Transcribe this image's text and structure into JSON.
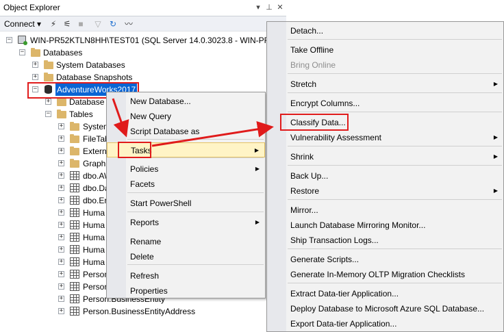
{
  "panel": {
    "title": "Object Explorer",
    "pin_glyph": "▾",
    "autohide_glyph": "📌",
    "close_glyph": "✕",
    "connect_label": "Connect ▾"
  },
  "tree": {
    "server": "WIN-PR52KTLN8HH\\TEST01 (SQL Server 14.0.3023.8 - WIN-PR52K",
    "databases": "Databases",
    "system_databases": "System Databases",
    "database_snapshots": "Database Snapshots",
    "selected_db": "AdventureWorks2017",
    "db_diagrams": "Database D",
    "tables": "Tables",
    "table_items": [
      "System",
      "FileTab",
      "Externa",
      "Graph",
      "dbo.AW",
      "dbo.Da",
      "dbo.Er",
      "Huma",
      "Huma",
      "Huma",
      "Huma",
      "Huma",
      "Person",
      "Person.AddressType",
      "Person.BusinessEntity",
      "Person.BusinessEntityAddress"
    ]
  },
  "context_menu": {
    "items": [
      "New Database...",
      "New Query",
      "Script Database as",
      "Tasks",
      "Policies",
      "Facets",
      "Start PowerShell",
      "Reports",
      "Rename",
      "Delete",
      "Refresh",
      "Properties"
    ]
  },
  "tasks_menu": {
    "items": [
      "Detach...",
      "Take Offline",
      "Bring Online",
      "Stretch",
      "Encrypt Columns...",
      "Classify Data...",
      "Vulnerability Assessment",
      "Shrink",
      "Back Up...",
      "Restore",
      "Mirror...",
      "Launch Database Mirroring Monitor...",
      "Ship Transaction Logs...",
      "Generate Scripts...",
      "Generate In-Memory OLTP Migration Checklists",
      "Extract Data-tier Application...",
      "Deploy Database to Microsoft Azure SQL Database...",
      "Export Data-tier Application..."
    ]
  },
  "colors": {
    "selection": "#0a64d4",
    "highlight_box": "#e01b1b",
    "menu_hover": "#fff4c6"
  }
}
